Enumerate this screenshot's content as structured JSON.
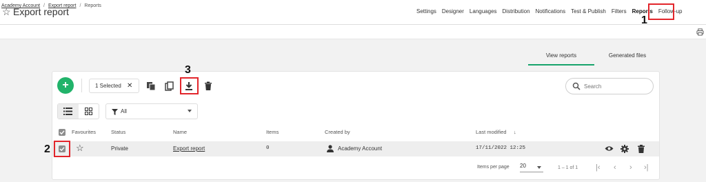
{
  "header": {
    "title": "Export report",
    "nav": [
      "Settings",
      "Designer",
      "Languages",
      "Distribution",
      "Notifications",
      "Test & Publish",
      "Filters",
      "Reports",
      "Follow-up"
    ],
    "active_nav": "Reports"
  },
  "breadcrumb": {
    "items": [
      "Academy Account",
      "Export report"
    ],
    "current": "Reports",
    "separator": "/"
  },
  "tabs": {
    "items": [
      "View reports",
      "Generated files"
    ],
    "active": "View reports"
  },
  "toolbar": {
    "add_label": "+",
    "selection_text": "1 Selected",
    "clear_label": "✕",
    "search_placeholder": "Search"
  },
  "filter": {
    "value": "All"
  },
  "table": {
    "columns": [
      "Favourites",
      "Status",
      "Name",
      "Items",
      "Created by",
      "Last modified"
    ],
    "sort_indicator": "↓",
    "rows": [
      {
        "selected": true,
        "favourite": "☆",
        "status": "Private",
        "name": "Export report",
        "items": "0",
        "created_by": "Academy Account",
        "last_modified": "17/11/2022 12:25"
      }
    ]
  },
  "pagination": {
    "items_per_page_label": "Items per page",
    "items_per_page_value": "20",
    "range_text": "1 – 1 of 1"
  },
  "annotations": [
    "1",
    "2",
    "3"
  ],
  "colors": {
    "accent": "#16a36b",
    "add_button": "#21b36a",
    "annotation": "#e2252b",
    "selected_row": "#eeeeee"
  },
  "icons": [
    "star-icon",
    "print-icon",
    "copy-icon",
    "duplicate-icon",
    "download-icon",
    "trash-icon",
    "search-icon",
    "list-view-icon",
    "grid-view-icon",
    "filter-icon",
    "person-icon",
    "eye-icon",
    "gear-icon",
    "first-page-icon",
    "prev-page-icon",
    "next-page-icon",
    "last-page-icon"
  ]
}
